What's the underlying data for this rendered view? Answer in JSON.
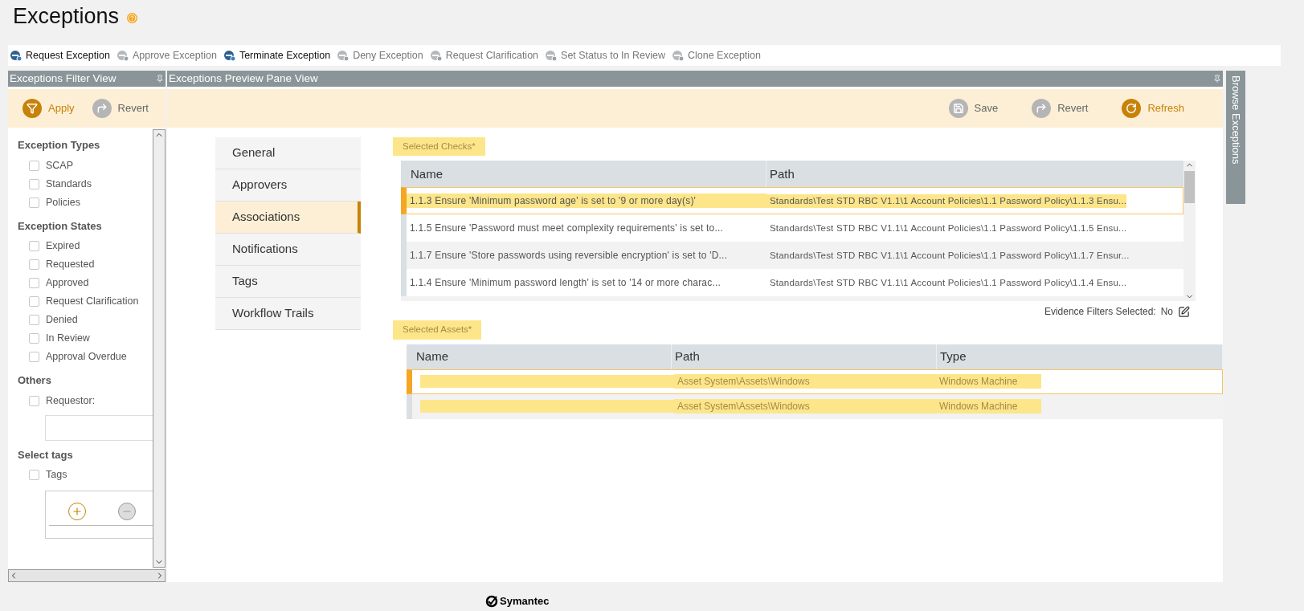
{
  "page": {
    "title": "Exceptions"
  },
  "toolbar": [
    {
      "label": "Request Exception",
      "disabled": false
    },
    {
      "label": "Approve Exception",
      "disabled": true
    },
    {
      "label": "Terminate Exception",
      "disabled": false
    },
    {
      "label": "Deny Exception",
      "disabled": true
    },
    {
      "label": "Request Clarification",
      "disabled": true
    },
    {
      "label": "Set Status to In Review",
      "disabled": true
    },
    {
      "label": "Clone Exception",
      "disabled": true
    }
  ],
  "filter_view": {
    "title": "Exceptions Filter View",
    "actions": [
      {
        "label": "Apply",
        "kind": "apply",
        "disabled": false
      },
      {
        "label": "Revert",
        "kind": "revert",
        "disabled": true
      }
    ],
    "groups": [
      {
        "title": "Exception Types",
        "kind": "list",
        "options": [
          {
            "label": "SCAP",
            "checked": false
          },
          {
            "label": "Standards",
            "checked": false
          },
          {
            "label": "Policies",
            "checked": false
          }
        ]
      },
      {
        "title": "Exception States",
        "kind": "list",
        "options": [
          {
            "label": "Expired",
            "checked": false
          },
          {
            "label": "Requested",
            "checked": false
          },
          {
            "label": "Approved",
            "checked": false
          },
          {
            "label": "Request Clarification",
            "checked": false
          },
          {
            "label": "Denied",
            "checked": false
          },
          {
            "label": "In Review",
            "checked": false
          },
          {
            "label": "Approval Overdue",
            "checked": false
          }
        ]
      },
      {
        "title": "Others",
        "kind": "field",
        "options": [
          {
            "label": "Requestor:",
            "checked": false
          }
        ]
      },
      {
        "title": "Select tags",
        "kind": "tags",
        "options": [
          {
            "label": "Tags",
            "checked": false
          }
        ]
      }
    ]
  },
  "preview": {
    "title": "Exceptions Preview Pane View",
    "actions": [
      {
        "label": "Save",
        "kind": "save",
        "disabled": true
      },
      {
        "label": "Revert",
        "kind": "revert",
        "disabled": true
      },
      {
        "label": "Refresh",
        "kind": "refresh",
        "disabled": false
      }
    ],
    "nav": [
      {
        "label": "General",
        "selected": false
      },
      {
        "label": "Approvers",
        "selected": false
      },
      {
        "label": "Associations",
        "selected": true
      },
      {
        "label": "Notifications",
        "selected": false
      },
      {
        "label": "Tags",
        "selected": false
      },
      {
        "label": "Workflow Trails",
        "selected": false
      }
    ],
    "checks": {
      "label": "Selected Checks*",
      "highlighted": true,
      "columns": [
        "Name",
        "Path"
      ],
      "rows": [
        {
          "name": "1.1.3  Ensure 'Minimum password age' is set to '9 or more day(s)'",
          "path": "Standards\\Test  STD  RBC  V1.1\\1  Account  Policies\\1.1  Password  Policy\\1.1.3    Ensu...",
          "selected": true,
          "highlighted": true
        },
        {
          "name": "1.1.5   Ensure 'Password must meet complexity requirements' is set to...",
          "path": "Standards\\Test  STD  RBC  V1.1\\1  Account  Policies\\1.1  Password  Policy\\1.1.5    Ensu...",
          "selected": false,
          "highlighted": false
        },
        {
          "name": "1.1.7 Ensure 'Store passwords using reversible encryption' is set to 'D...",
          "path": "Standards\\Test  STD  RBC  V1.1\\1  Account  Policies\\1.1  Password  Policy\\1.1.7  Ensur...",
          "selected": false,
          "highlighted": false
        },
        {
          "name": "1.1.4  Ensure 'Minimum password length' is set to '14 or more charac...",
          "path": "Standards\\Test  STD  RBC  V1.1\\1  Account  Policies\\1.1  Password  Policy\\1.1.4    Ensu...",
          "selected": false,
          "highlighted": false
        }
      ]
    },
    "evidence": {
      "label": "Evidence Filters Selected:",
      "value": "No"
    },
    "assets": {
      "label": "Selected Assets*",
      "highlighted": true,
      "columns": [
        "Name",
        "Path",
        "Type"
      ],
      "rows": [
        {
          "path": "Asset System\\Assets\\Windows",
          "type": "Windows Machine",
          "selected": true,
          "highlighted": true
        },
        {
          "path": "Asset System\\Assets\\Windows",
          "type": "Windows Machine",
          "selected": false,
          "highlighted": true
        }
      ]
    }
  },
  "side_tab": {
    "label": "Browse Exceptions"
  },
  "footer": {
    "logo": "Symantec"
  }
}
